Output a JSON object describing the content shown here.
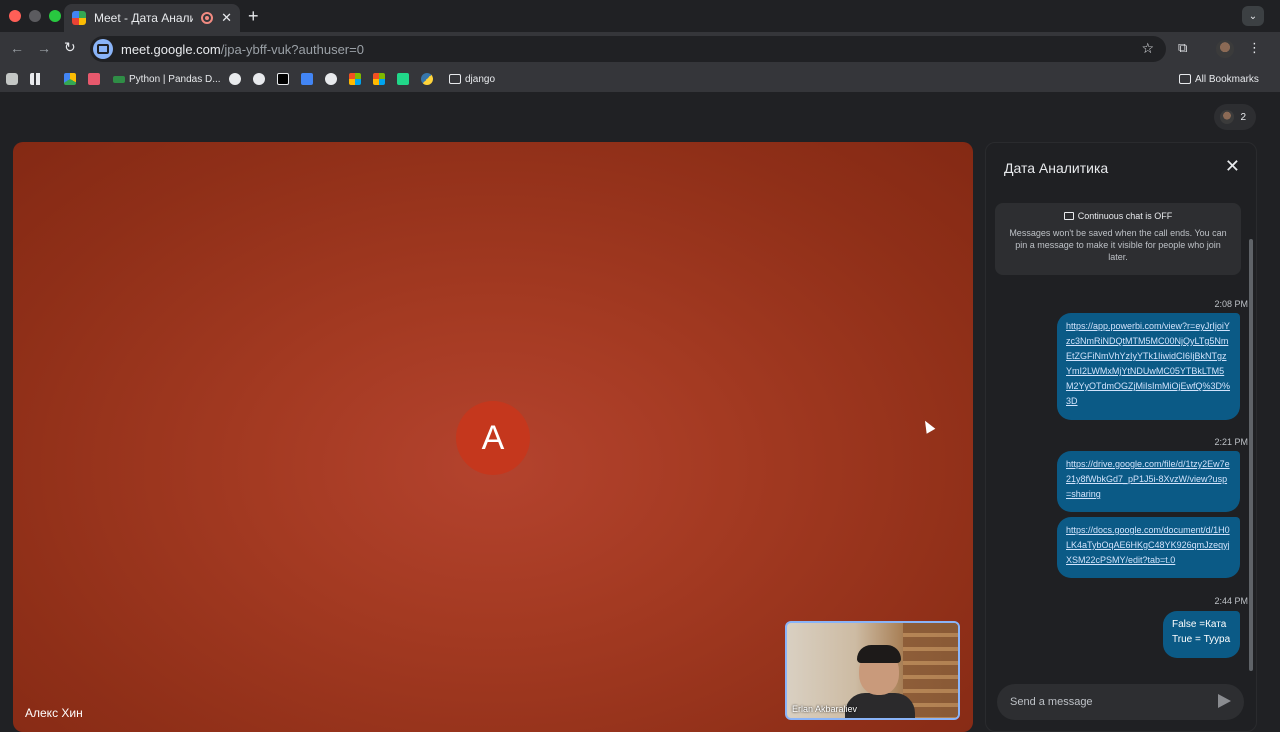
{
  "browser": {
    "tab_title": "Meet - Дата Аналитика",
    "tab_close": "✕",
    "new_tab": "+",
    "tab_menu": "⌄",
    "url_host": "meet.google.com",
    "url_path": "/jpa-ybff-vuk?authuser=0",
    "bookmarks": {
      "python": "Python | Pandas D...",
      "django": "django",
      "all": "All Bookmarks"
    }
  },
  "meet": {
    "participants_count": "2",
    "main_tile": {
      "initial": "A",
      "name": "Алекс Хин",
      "avatar_color": "#c5371d"
    },
    "self_view": {
      "name": "Erlan Akbaraliev"
    }
  },
  "chat": {
    "title": "Дата Аналитика",
    "notice_title": "Continuous chat is OFF",
    "notice_body": "Messages won't be saved when the call ends. You can pin a message to make it visible for people who join later.",
    "messages": [
      {
        "time": "2:08 PM",
        "text": "https://app.powerbi.com/view?r=eyJrIjoiYzc3NmRiNDQtMTM5MC00NjQyLTg5NmEtZGFiNmVhYzIyYTk1IiwidCI6IjBkNTgzYmI2LWMxMjYtNDUwMC05YTBkLTM5M2YyOTdmOGZjMiIsImMiOjEwfQ%3D%3D"
      },
      {
        "time": "2:21 PM",
        "text": "https://drive.google.com/file/d/1tzy2Ew7e21y8fWbkGd7_pP1J5i-8XvzW/view?usp=sharing"
      },
      {
        "time": "",
        "text": "https://docs.google.com/document/d/1H0LK4aTybOqAE6HKgC48YK926qmJzeqyjXSM22cPSMY/edit?tab=t.0"
      },
      {
        "time": "2:44 PM",
        "text": "False =Ката\nTrue = Туура"
      }
    ],
    "compose_placeholder": "Send a message"
  }
}
